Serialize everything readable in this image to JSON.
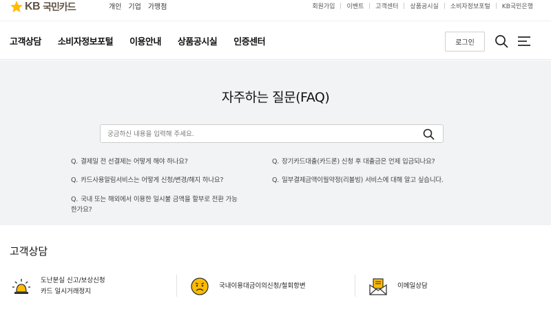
{
  "brand": {
    "logo_kb": "KB",
    "logo_name": "국민카드"
  },
  "segment_nav": [
    "개인",
    "기업",
    "가맹점"
  ],
  "util_links": [
    "회원가입",
    "이벤트",
    "고객센터",
    "상품공시실",
    "소비자정보포털",
    "KB국민은행"
  ],
  "main_nav": {
    "items": [
      "고객상담",
      "소비자정보포털",
      "이용안내",
      "상품공시실",
      "인증센터"
    ],
    "login_label": "로그인"
  },
  "faq": {
    "title": "자주하는 질문(FAQ)",
    "search_placeholder": "궁금하신 내용을 입력해 주세요.",
    "prefix": "Q.",
    "questions_left": [
      "결제일 전 선결제는 어떻게 해야 하나요?",
      "카드사용알림서비스는 어떻게 신청/변경/해지 하나요?",
      "국내 또는 해외에서 이용한 일시불 금액을 할부로 전환 가능한가요?"
    ],
    "questions_right": [
      "장기카드대출(카드론) 신청 후 대출금은 언제 입금되나요?",
      "일부결제금액이월약정(리볼빙) 서비스에 대해 알고 싶습니다."
    ]
  },
  "customer_consult": {
    "title": "고객상담",
    "items": [
      {
        "icon": "siren-icon",
        "line1": "도난분실 신고/보상신청",
        "line2": "카드 일시거래정지"
      },
      {
        "icon": "sad-face-icon",
        "line1": "국내이용대금이의신청/철회항변",
        "line2": ""
      },
      {
        "icon": "email-icon",
        "line1": "이메일상담",
        "line2": ""
      }
    ]
  },
  "colors": {
    "brand_yellow": "#ffbc00",
    "brand_brown": "#5f5242",
    "faq_bg": "#f1f3f5"
  }
}
